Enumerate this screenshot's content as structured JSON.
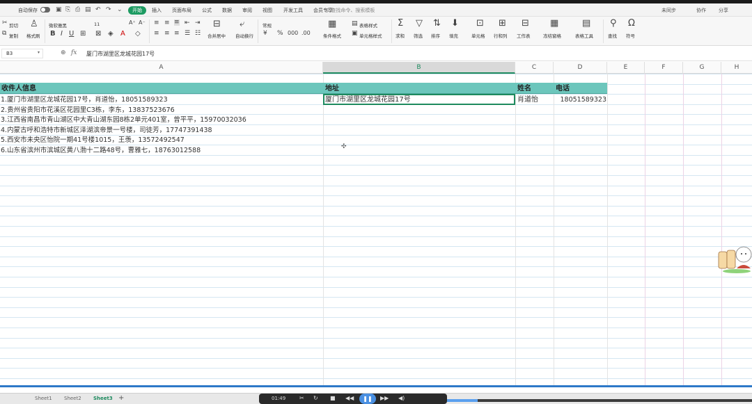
{
  "menubar": {
    "autosave_label": "自动保存",
    "tabs": [
      {
        "label": "开始",
        "active": true
      },
      {
        "label": "插入",
        "active": false
      },
      {
        "label": "页面布局",
        "active": false
      },
      {
        "label": "公式",
        "active": false
      },
      {
        "label": "数据",
        "active": false
      },
      {
        "label": "审阅",
        "active": false
      },
      {
        "label": "视图",
        "active": false
      },
      {
        "label": "开发工具",
        "active": false
      },
      {
        "label": "会员专享",
        "active": false
      }
    ],
    "search_placeholder": "查找命令、搜索模板",
    "right_items": [
      "未同步",
      "协作",
      "分享"
    ]
  },
  "ribbon": {
    "cut": "剪切",
    "copy": "复制",
    "format_painter": "格式刷",
    "paste": "粘贴",
    "font_name": "微软雅黑",
    "font_size": "11",
    "merge_center": "合并居中",
    "wrap_text": "自动换行",
    "number_format": "常规",
    "conditional_format": "条件格式",
    "table_style": "表格样式",
    "cell_style": "单元格样式",
    "sum": "求和",
    "filter": "筛选",
    "sort": "排序",
    "fill": "填充",
    "cell": "单元格",
    "row_col": "行和列",
    "worksheet": "工作表",
    "freeze": "冻结窗格",
    "table_tools": "表格工具",
    "find": "查找",
    "symbol": "符号"
  },
  "formula_bar": {
    "name_box": "B3",
    "fx": "fx",
    "content": "厦门市湖里区龙城花园17号"
  },
  "columns": [
    "A",
    "B",
    "C",
    "D",
    "E",
    "F",
    "G",
    "H"
  ],
  "selected_column": "B",
  "sheet": {
    "headers": {
      "a": "收件人信息",
      "b": "地址",
      "c": "姓名",
      "d": "电话"
    },
    "rows": [
      {
        "a": "1.厦门市湖里区龙城花园17号，肖道怡，18051589323",
        "b": "厦门市湖里区龙城花园17号",
        "c": "肖道怡",
        "d": "18051589323"
      },
      {
        "a": "2.贵州省贵阳市花溪区花园里C3栋，李东，13837523676",
        "b": "",
        "c": "",
        "d": ""
      },
      {
        "a": "3.江西省南昌市青山湖区中大青山湖东园8栋2单元401室，曾平平，15970032036",
        "b": "",
        "c": "",
        "d": ""
      },
      {
        "a": "4.内蒙古呼和浩特市新城区泽湖滨帝景一号楼，司徒芳，17747391438",
        "b": "",
        "c": "",
        "d": ""
      },
      {
        "a": "5.西安市未央区怡院一期41号楼1015，王羡，13572492547",
        "b": "",
        "c": "",
        "d": ""
      },
      {
        "a": "6.山东省滨州市滨城区黄八渤十二路48号，曹雅七，18763012588",
        "b": "",
        "c": "",
        "d": ""
      }
    ]
  },
  "sheet_tabs": [
    {
      "label": "Sheet1",
      "active": false
    },
    {
      "label": "Sheet2",
      "active": false
    },
    {
      "label": "Sheet3",
      "active": true
    }
  ],
  "player": {
    "time": "01:49",
    "progress": 0.1
  }
}
